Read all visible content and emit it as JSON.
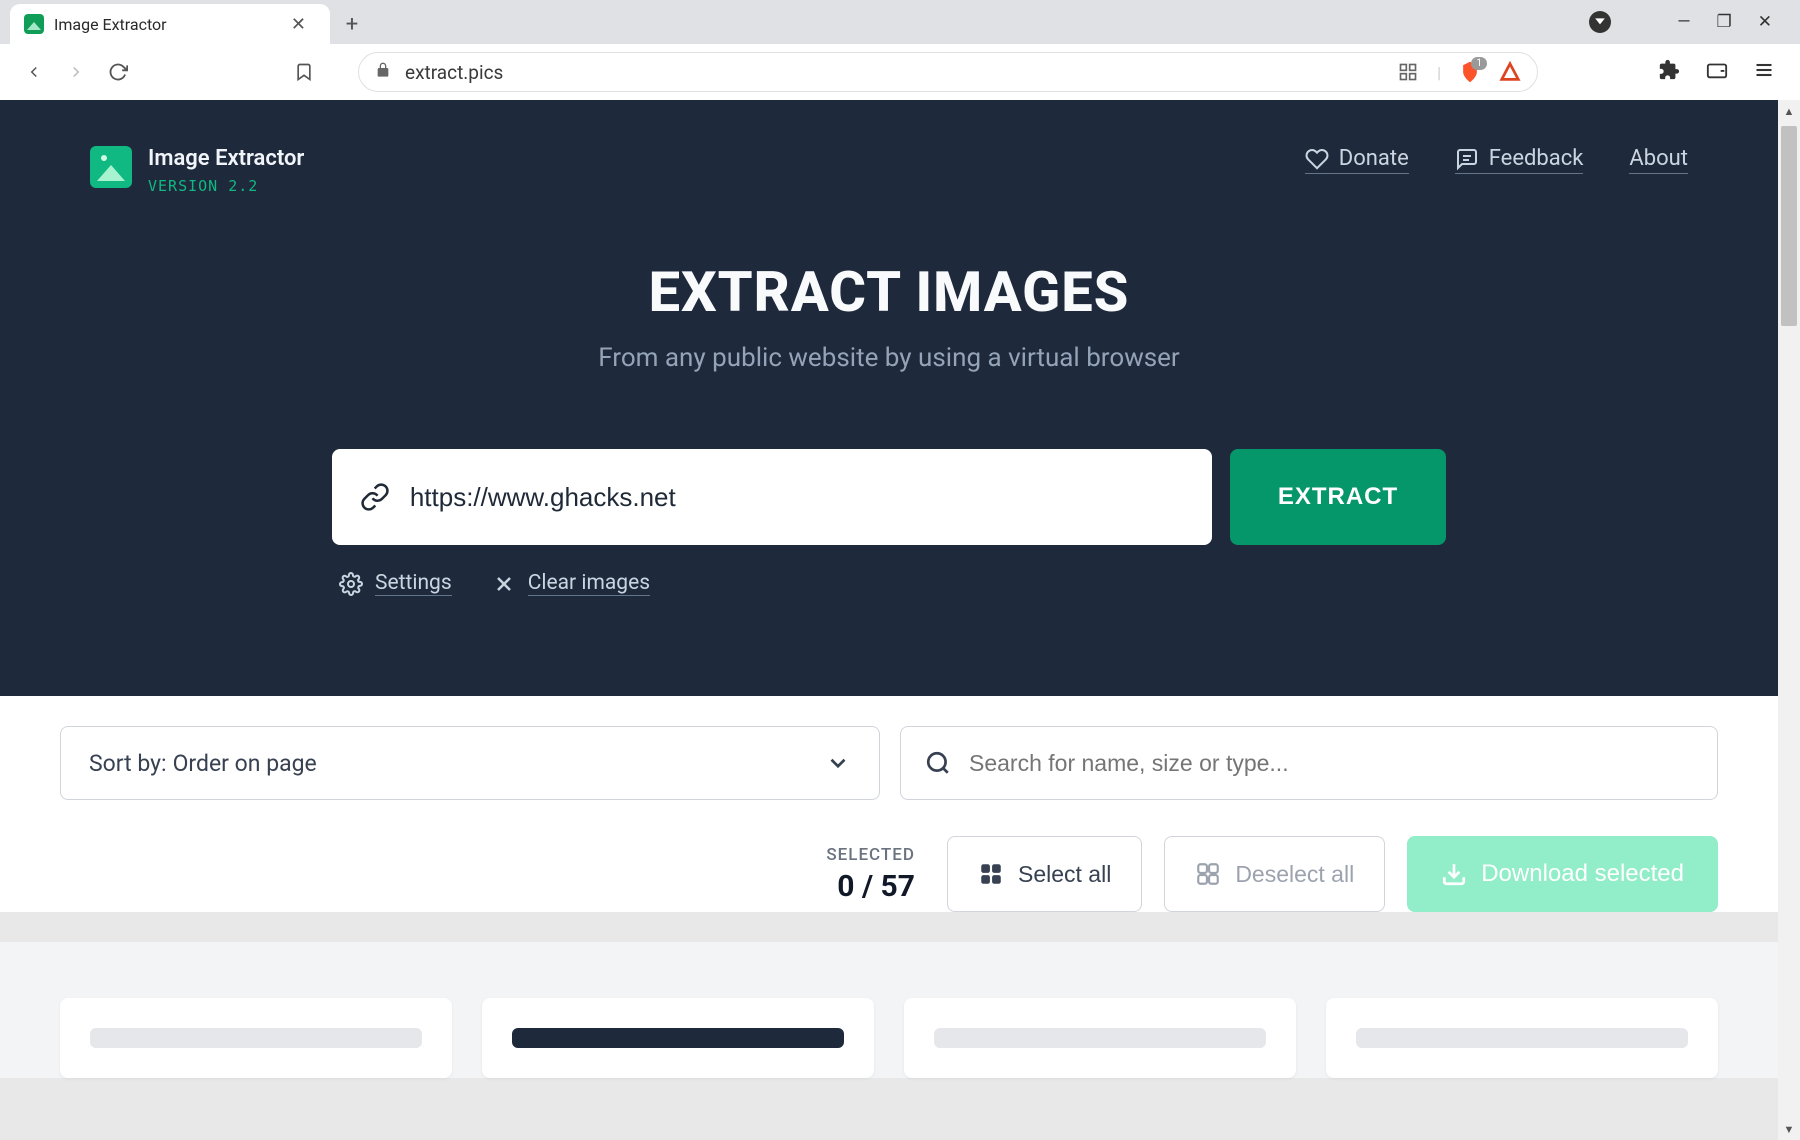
{
  "browser": {
    "tab_title": "Image Extractor",
    "address": "extract.pics",
    "shield_count": "1"
  },
  "site": {
    "brand_name": "Image Extractor",
    "version": "VERSION 2.2",
    "nav": {
      "donate": "Donate",
      "feedback": "Feedback",
      "about": "About"
    },
    "hero": {
      "title": "EXTRACT IMAGES",
      "subtitle": "From any public website by using a virtual browser"
    },
    "url_input": {
      "value": "https://www.ghacks.net",
      "button": "EXTRACT"
    },
    "under": {
      "settings": "Settings",
      "clear": "Clear images"
    }
  },
  "results": {
    "sort_prefix": "Sort by:",
    "sort_value": "Order on page",
    "search_placeholder": "Search for name, size or type...",
    "selected_label": "SELECTED",
    "selected_count": "0 / 57",
    "select_all": "Select all",
    "deselect_all": "Deselect all",
    "download": "Download selected"
  }
}
